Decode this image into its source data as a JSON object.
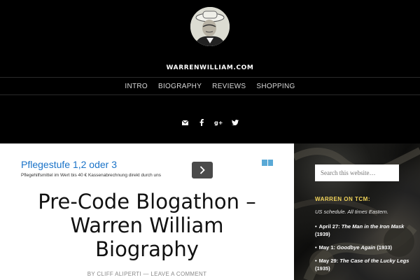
{
  "site": {
    "title": "WARRENWILLIAM.COM"
  },
  "nav": {
    "items": [
      "INTRO",
      "BIOGRAPHY",
      "REVIEWS",
      "SHOPPING"
    ]
  },
  "social": {
    "icons": [
      "mail-icon",
      "facebook-icon",
      "google-plus-icon",
      "twitter-icon"
    ]
  },
  "ad": {
    "title": "Pflegestufe 1,2 oder 3",
    "subtitle": "Pflegehilfsmittel im Wert bis 40 € Kassenabrechnung direkt durch uns",
    "button_icon": "chevron-right-icon"
  },
  "post": {
    "title_lines": [
      "Pre-Code Blogathon –",
      "Warren William",
      "Biography"
    ],
    "byline": {
      "prefix": "BY",
      "author": "CLIFF ALIPERTI",
      "separator": "—",
      "comments": "LEAVE A COMMENT"
    }
  },
  "sidebar": {
    "search_placeholder": "Search this website…",
    "widget_title": "WARREN ON TCM:",
    "widget_note": "US schedule. All times Eastern.",
    "schedule": [
      {
        "date": "April 27:",
        "film": "The Man in the Iron Mask",
        "year": "(1939)"
      },
      {
        "date": "May 1:",
        "film": "Goodbye Again",
        "year": "(1933)"
      },
      {
        "date": "May 29:",
        "film": "The Case of the Lucky Legs",
        "year": "(1935)"
      }
    ]
  },
  "colors": {
    "accent": "#f0d35a",
    "link": "#1a73c8",
    "header_bg": "#000000"
  }
}
